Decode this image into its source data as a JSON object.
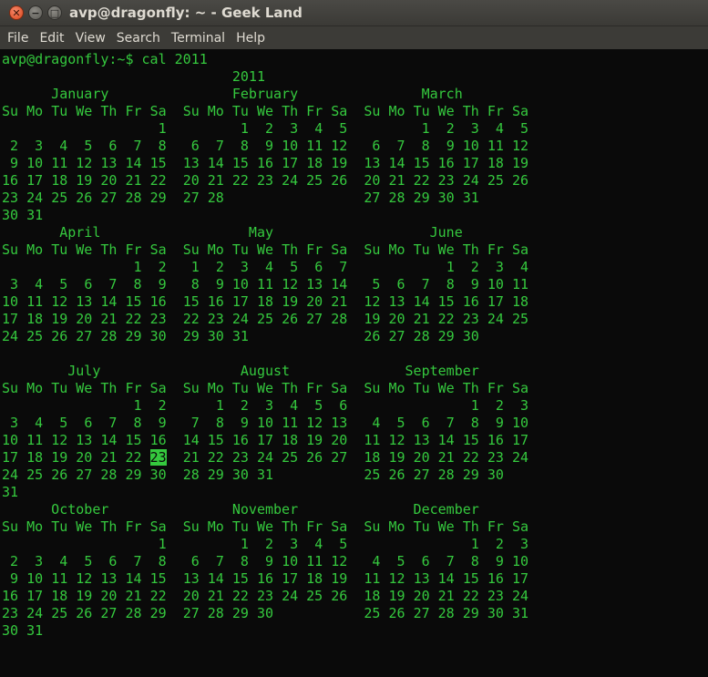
{
  "window": {
    "title": "avp@dragonfly: ~ - Geek Land"
  },
  "menu": [
    "File",
    "Edit",
    "View",
    "Search",
    "Terminal",
    "Help"
  ],
  "terminal": {
    "prompt": "avp@dragonfly:~$ ",
    "command": "cal 2011",
    "year": "2011",
    "highlight": {
      "month": 6,
      "day": 23
    },
    "days_header": [
      "Su",
      "Mo",
      "Tu",
      "We",
      "Th",
      "Fr",
      "Sa"
    ],
    "months": [
      {
        "name": "January",
        "weeks": [
          [
            "",
            "",
            "",
            "",
            "",
            "",
            "1"
          ],
          [
            "2",
            "3",
            "4",
            "5",
            "6",
            "7",
            "8"
          ],
          [
            "9",
            "10",
            "11",
            "12",
            "13",
            "14",
            "15"
          ],
          [
            "16",
            "17",
            "18",
            "19",
            "20",
            "21",
            "22"
          ],
          [
            "23",
            "24",
            "25",
            "26",
            "27",
            "28",
            "29"
          ],
          [
            "30",
            "31",
            "",
            "",
            "",
            "",
            ""
          ]
        ]
      },
      {
        "name": "February",
        "weeks": [
          [
            "",
            "",
            "1",
            "2",
            "3",
            "4",
            "5"
          ],
          [
            "6",
            "7",
            "8",
            "9",
            "10",
            "11",
            "12"
          ],
          [
            "13",
            "14",
            "15",
            "16",
            "17",
            "18",
            "19"
          ],
          [
            "20",
            "21",
            "22",
            "23",
            "24",
            "25",
            "26"
          ],
          [
            "27",
            "28",
            "",
            "",
            "",
            "",
            ""
          ],
          [
            "",
            "",
            "",
            "",
            "",
            "",
            ""
          ]
        ]
      },
      {
        "name": "March",
        "weeks": [
          [
            "",
            "",
            "1",
            "2",
            "3",
            "4",
            "5"
          ],
          [
            "6",
            "7",
            "8",
            "9",
            "10",
            "11",
            "12"
          ],
          [
            "13",
            "14",
            "15",
            "16",
            "17",
            "18",
            "19"
          ],
          [
            "20",
            "21",
            "22",
            "23",
            "24",
            "25",
            "26"
          ],
          [
            "27",
            "28",
            "29",
            "30",
            "31",
            "",
            ""
          ],
          [
            "",
            "",
            "",
            "",
            "",
            "",
            ""
          ]
        ]
      },
      {
        "name": "April",
        "weeks": [
          [
            "",
            "",
            "",
            "",
            "",
            "1",
            "2"
          ],
          [
            "3",
            "4",
            "5",
            "6",
            "7",
            "8",
            "9"
          ],
          [
            "10",
            "11",
            "12",
            "13",
            "14",
            "15",
            "16"
          ],
          [
            "17",
            "18",
            "19",
            "20",
            "21",
            "22",
            "23"
          ],
          [
            "24",
            "25",
            "26",
            "27",
            "28",
            "29",
            "30"
          ],
          [
            "",
            "",
            "",
            "",
            "",
            "",
            ""
          ]
        ]
      },
      {
        "name": "May",
        "weeks": [
          [
            "1",
            "2",
            "3",
            "4",
            "5",
            "6",
            "7"
          ],
          [
            "8",
            "9",
            "10",
            "11",
            "12",
            "13",
            "14"
          ],
          [
            "15",
            "16",
            "17",
            "18",
            "19",
            "20",
            "21"
          ],
          [
            "22",
            "23",
            "24",
            "25",
            "26",
            "27",
            "28"
          ],
          [
            "29",
            "30",
            "31",
            "",
            "",
            "",
            ""
          ],
          [
            "",
            "",
            "",
            "",
            "",
            "",
            ""
          ]
        ]
      },
      {
        "name": "June",
        "weeks": [
          [
            "",
            "",
            "",
            "1",
            "2",
            "3",
            "4"
          ],
          [
            "5",
            "6",
            "7",
            "8",
            "9",
            "10",
            "11"
          ],
          [
            "12",
            "13",
            "14",
            "15",
            "16",
            "17",
            "18"
          ],
          [
            "19",
            "20",
            "21",
            "22",
            "23",
            "24",
            "25"
          ],
          [
            "26",
            "27",
            "28",
            "29",
            "30",
            "",
            ""
          ],
          [
            "",
            "",
            "",
            "",
            "",
            "",
            ""
          ]
        ]
      },
      {
        "name": "July",
        "weeks": [
          [
            "",
            "",
            "",
            "",
            "",
            "1",
            "2"
          ],
          [
            "3",
            "4",
            "5",
            "6",
            "7",
            "8",
            "9"
          ],
          [
            "10",
            "11",
            "12",
            "13",
            "14",
            "15",
            "16"
          ],
          [
            "17",
            "18",
            "19",
            "20",
            "21",
            "22",
            "23"
          ],
          [
            "24",
            "25",
            "26",
            "27",
            "28",
            "29",
            "30"
          ],
          [
            "31",
            "",
            "",
            "",
            "",
            "",
            ""
          ]
        ]
      },
      {
        "name": "August",
        "weeks": [
          [
            "",
            "1",
            "2",
            "3",
            "4",
            "5",
            "6"
          ],
          [
            "7",
            "8",
            "9",
            "10",
            "11",
            "12",
            "13"
          ],
          [
            "14",
            "15",
            "16",
            "17",
            "18",
            "19",
            "20"
          ],
          [
            "21",
            "22",
            "23",
            "24",
            "25",
            "26",
            "27"
          ],
          [
            "28",
            "29",
            "30",
            "31",
            "",
            "",
            ""
          ],
          [
            "",
            "",
            "",
            "",
            "",
            "",
            ""
          ]
        ]
      },
      {
        "name": "September",
        "weeks": [
          [
            "",
            "",
            "",
            "",
            "1",
            "2",
            "3"
          ],
          [
            "4",
            "5",
            "6",
            "7",
            "8",
            "9",
            "10"
          ],
          [
            "11",
            "12",
            "13",
            "14",
            "15",
            "16",
            "17"
          ],
          [
            "18",
            "19",
            "20",
            "21",
            "22",
            "23",
            "24"
          ],
          [
            "25",
            "26",
            "27",
            "28",
            "29",
            "30",
            ""
          ],
          [
            "",
            "",
            "",
            "",
            "",
            "",
            ""
          ]
        ]
      },
      {
        "name": "October",
        "weeks": [
          [
            "",
            "",
            "",
            "",
            "",
            "",
            "1"
          ],
          [
            "2",
            "3",
            "4",
            "5",
            "6",
            "7",
            "8"
          ],
          [
            "9",
            "10",
            "11",
            "12",
            "13",
            "14",
            "15"
          ],
          [
            "16",
            "17",
            "18",
            "19",
            "20",
            "21",
            "22"
          ],
          [
            "23",
            "24",
            "25",
            "26",
            "27",
            "28",
            "29"
          ],
          [
            "30",
            "31",
            "",
            "",
            "",
            "",
            ""
          ]
        ]
      },
      {
        "name": "November",
        "weeks": [
          [
            "",
            "",
            "1",
            "2",
            "3",
            "4",
            "5"
          ],
          [
            "6",
            "7",
            "8",
            "9",
            "10",
            "11",
            "12"
          ],
          [
            "13",
            "14",
            "15",
            "16",
            "17",
            "18",
            "19"
          ],
          [
            "20",
            "21",
            "22",
            "23",
            "24",
            "25",
            "26"
          ],
          [
            "27",
            "28",
            "29",
            "30",
            "",
            "",
            ""
          ],
          [
            "",
            "",
            "",
            "",
            "",
            "",
            ""
          ]
        ]
      },
      {
        "name": "December",
        "weeks": [
          [
            "",
            "",
            "",
            "",
            "1",
            "2",
            "3"
          ],
          [
            "4",
            "5",
            "6",
            "7",
            "8",
            "9",
            "10"
          ],
          [
            "11",
            "12",
            "13",
            "14",
            "15",
            "16",
            "17"
          ],
          [
            "18",
            "19",
            "20",
            "21",
            "22",
            "23",
            "24"
          ],
          [
            "25",
            "26",
            "27",
            "28",
            "29",
            "30",
            "31"
          ],
          [
            "",
            "",
            "",
            "",
            "",
            "",
            ""
          ]
        ]
      }
    ]
  }
}
